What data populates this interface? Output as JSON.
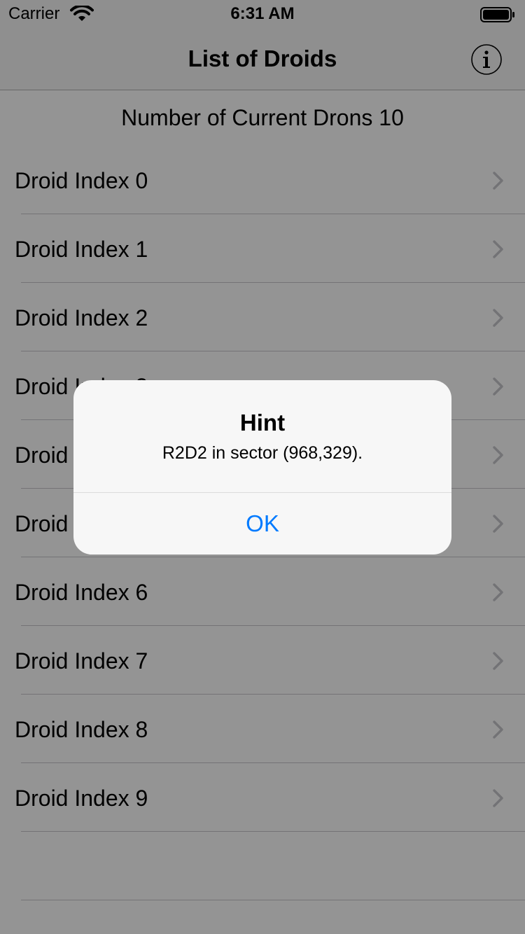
{
  "status_bar": {
    "carrier": "Carrier",
    "time": "6:31 AM"
  },
  "nav": {
    "title": "List of Droids",
    "info_icon": "info-circle-icon"
  },
  "count_label": "Number of Current Drons 10",
  "droids": [
    "Droid Index 0",
    "Droid Index 1",
    "Droid Index 2",
    "Droid Index 3",
    "Droid Index 4",
    "Droid Index 5",
    "Droid Index 6",
    "Droid Index 7",
    "Droid Index 8",
    "Droid Index 9"
  ],
  "alert": {
    "title": "Hint",
    "message": "R2D2 in sector (968,329).",
    "ok_label": "OK"
  },
  "colors": {
    "accent": "#007aff",
    "chevron": "#c7c7cc",
    "separator": "#c8c7cc"
  }
}
